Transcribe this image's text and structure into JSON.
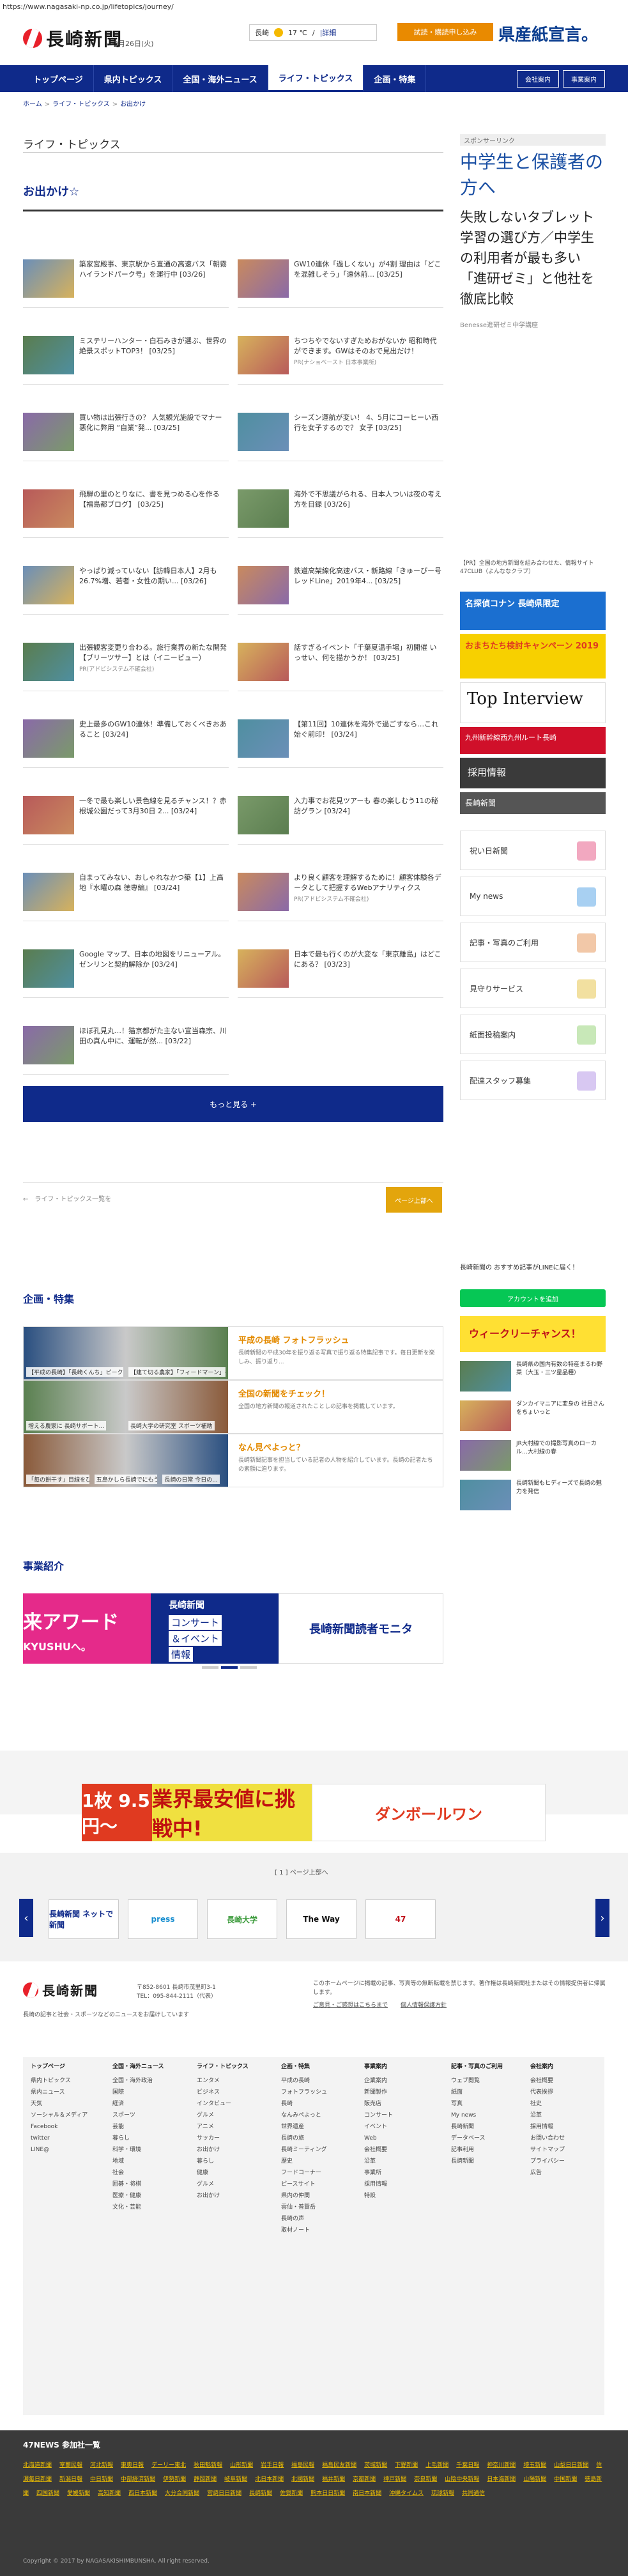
{
  "url": "https://www.nagasaki-np.co.jp/lifetopics/journey/",
  "header": {
    "logo_text": "長崎新聞",
    "date": "3月26日(火)",
    "weather_city": "長崎",
    "weather_temp": "17 ℃",
    "weather_detail": "/",
    "weather_more": "|詳細",
    "subscribe_label": "試読・購読申し込み",
    "banner_top": "県産紙宣言。"
  },
  "nav": {
    "items": [
      "トップページ",
      "県内トピックス",
      "全国・海外ニュース",
      "ライフ・トピックス",
      "企画・特集"
    ],
    "active_index": 3,
    "right": [
      "会社案内",
      "事業案内"
    ]
  },
  "breadcrumb": [
    "ホーム",
    ">",
    "ライフ・トピックス",
    ">",
    "お出かけ"
  ],
  "section_title": "ライフ・トピックス",
  "category_title": "お出かけ☆",
  "articles": [
    {
      "text": "築家宮殿事、東京駅から直通の高速バス「朝霧ハイランドパーク号」を運行中",
      "date": "[03/26]",
      "sub": ""
    },
    {
      "text": "GW10連休「過しくない」が4割 理由は「どこを混雑しそう」「遠休前...",
      "date": "[03/25]",
      "sub": ""
    },
    {
      "text": "ミステリーハンター・白石みきが選ぶ、世界の絶景スポットTOP3！",
      "date": "[03/25]",
      "sub": ""
    },
    {
      "text": "ちつちやでないすぎためおがないか 昭和時代ができます。GWはそのおで見出だけ！",
      "date": "",
      "sub": "PR(ナショベースト 日本事業所)"
    },
    {
      "text": "買い物は出張行きの？ 人気観光施設でマナー悪化に弊用 “自業”発...",
      "date": "[03/25]",
      "sub": ""
    },
    {
      "text": "シーズン運航が変い！ 4、5月にコーヒーい西行を女子するので？ 女子",
      "date": "[03/25]",
      "sub": ""
    },
    {
      "text": "飛騨の里のとりなに、書を見つめる心を作る【福島都ブログ】",
      "date": "[03/25]",
      "sub": ""
    },
    {
      "text": "海外で不思議がられる、日本人ついは夜の考え方を目録",
      "date": "[03/26]",
      "sub": ""
    },
    {
      "text": "やっぱり減っていない【訪韓日本人】2月も26.7%増、若者・女性の期い...",
      "date": "[03/26]",
      "sub": ""
    },
    {
      "text": "鉄道高架線化高速バス・新路線「きゅーびー号レッドLine」2019年4...",
      "date": "[03/25]",
      "sub": ""
    },
    {
      "text": "出張観客変更り合わる。旅行業界の新たな開発【ブリーツサー】とは（イニービュー）",
      "date": "",
      "sub": "PR(アドビシステム不確会社)"
    },
    {
      "text": "話すぎるイベント「千葉夏温手場」初開催 いっせい、何を描かうか！",
      "date": "[03/25]",
      "sub": ""
    },
    {
      "text": "史上最多のGW10連休！準備しておくべきおあること",
      "date": "[03/24]",
      "sub": ""
    },
    {
      "text": "【第11回】10連休を海外で過ごすなら…これ始ぐ前印！",
      "date": "[03/24]",
      "sub": ""
    },
    {
      "text": "一冬で最も楽しい景色線を見るチャンス！？赤根城公園だって3月30日 2...",
      "date": "[03/24]",
      "sub": ""
    },
    {
      "text": "入力事でお花見ツアーも 春の楽しむう11の秘訪グラン",
      "date": "[03/24]",
      "sub": ""
    },
    {
      "text": "自まってみない、おしゃれなかつ築【1】上高地『水曜の森 徳専編』",
      "date": "[03/24]",
      "sub": ""
    },
    {
      "text": "より良く顧客を理解するために！顧客体験各データとして把握するWebアナリティクス",
      "date": "",
      "sub": "PR(アドビシステム不確会社)"
    },
    {
      "text": "Google マップ、日本の地図をリニューアル。ゼンリンと契約解除か",
      "date": "[03/24]",
      "sub": ""
    },
    {
      "text": "日本で最も行くのが大変な「東京離島」はどこにある？",
      "date": "[03/23]",
      "sub": ""
    },
    {
      "text": "ほぼ孔見丸…！猫京都がた主ない宣当森宗、川田の真ん中に、運転が然...",
      "date": "[03/22]",
      "sub": ""
    }
  ],
  "more_label": "もっと見る +",
  "pager": {
    "back": "←　ライフ・トピックス一覧を",
    "next": "ページ上部へ"
  },
  "features_title": "企画・特集",
  "features": [
    {
      "title": "平成の長崎 フォトフラッシュ",
      "desc": "長崎新聞の平成30年を振り返る写真で振り返る特集記事です。毎日更新を楽しみ、振り返り..."
    },
    {
      "title": "全国の新聞をチェック！",
      "desc": "全国の地方新聞の報道されたことしの記事を掲載しています。"
    },
    {
      "title": "なん見ぺよっと？",
      "desc": "長崎新聞記事を担当している記者の人物を紹介しています。長崎の記者たちの素顔に迫ります。"
    }
  ],
  "feature_caps": [
    [
      "【平成の長崎】「長崎くんち」ピーク",
      "【建て切る農家】「フィードマーン」長崎の挑戦"
    ],
    [
      "増える農家に 長崎サポート...",
      "長崎大学の研究室 スポーツ補助"
    ],
    [
      "「毎の餅干す」目線をひたちで、長崎の...",
      "五島かしら長崎でにもう一度本来の...",
      "長崎の日常 今日の..."
    ]
  ],
  "business_title": "事業紹介",
  "carousel": {
    "pink": "来アワード",
    "pink_sub": "KYUSHUへ。",
    "blue_title": "長崎新聞",
    "blue_line1": "コンサート",
    "blue_line2": "＆イベント",
    "blue_line3": "情報",
    "white": "長崎新聞読者モニタ"
  },
  "sidebar": {
    "sponsor_label": "スポンサーリンク",
    "ad_heading": "中学生と保護者の方へ",
    "ad_body": "失敗しないタブレット学習の選び方／中学生の利用者が最も多い「進研ゼミ」と他社を徹底比較",
    "ad_source": "Benesse進研ゼミ中学講座",
    "pr_note": "【PR】全国の地方新聞を組み合わせた、情報サイト47CLUB（よんななクラブ）",
    "banner1": "名探偵コナン 長崎県限定",
    "banner2": "おまちたち検討キャンペーン 2019",
    "banner3": "Top Interview",
    "banner4": "九州新幹線西九州ルート長崎",
    "banner5": "採用情報",
    "banner6": "長崎新聞",
    "buttons": [
      "祝い日新聞",
      "My news",
      "記事・写真のご利用",
      "見守りサービス",
      "紙面投稿案内",
      "配達スタッフ募集"
    ],
    "line_title": "長崎新聞の おすすめ記事がLINEに届く！",
    "line_btn": "アカウントを追加",
    "ticket_banner": "ウィークリーチャンス！",
    "news": [
      "長崎県の国内有数の特産まるわ野菜（大玉・三ツ星品種）",
      "ダンカイマニアに変身の 社員さんをちょいっと",
      "JR大村線での撮影写真のローカル…大村線の春",
      "長崎新聞もヒディーズで長崎の魅力を発信"
    ]
  },
  "bottom_ad": {
    "left": "1枚 9.5円〜",
    "mid": "業界最安値に挑戦中!",
    "right": "ダンボールワン"
  },
  "pages_label": "[ 1 ] ページ上部へ",
  "logos": [
    "長崎新聞 ネットで新聞",
    "press",
    "長崎大学",
    "The Way",
    "47"
  ],
  "footer": {
    "logo": "長崎新聞",
    "address": "〒852-8601 長崎市茂里町3-1",
    "tel": "TEL：095-844-2111（代表）",
    "desc": "長崎の記事と社会・スポーツなどのニュースをお届けしています",
    "right1": "このホームページに掲載の記事、写真等の無断転載を禁じます。著作権は長崎新聞社またはその情報提供者に帰属します。",
    "right2": "ご意見・ご感想はこちらまで",
    "privacy": "個人情報保護方針",
    "cols": [
      {
        "head": "トップページ",
        "items": [
          "県内トピックス",
          "県内ニュース",
          "天気",
          "ソーシャル＆メディア",
          "Facebook",
          "twitter",
          "LINE@"
        ]
      },
      {
        "head": "全国・海外ニュース",
        "items": [
          "全国・海外政治",
          "国際",
          "経済",
          "スポーツ",
          "芸能",
          "暮らし",
          "科学・環境",
          "地域",
          "社会",
          "囲碁・将棋",
          "医療・健康",
          "文化・芸能"
        ]
      },
      {
        "head": "ライフ・トピックス",
        "items": [
          "エンタメ",
          "ビジネス",
          "インタビュー",
          "グルメ",
          "アニメ",
          "サッカー",
          "お出かけ",
          "暮らし",
          "健康",
          "グルメ",
          "お出かけ"
        ]
      },
      {
        "head": "企画・特集",
        "items": [
          "平成の長崎",
          "フォトフラッシュ",
          "長崎",
          "なんみぺよっと",
          "世界遺産",
          "長崎の旅",
          "長崎ミーティング",
          "歴史",
          "フードコーナー",
          "ピースサイト",
          "県内の仲間",
          "雲仙・普賢岳",
          "長崎の声",
          "取材ノート"
        ]
      },
      {
        "head": "事業案内",
        "items": [
          "企業案内",
          "新聞製作",
          "販売店",
          "コンサート",
          "イベント",
          "Web",
          "会社概要",
          "沿革",
          "事業所",
          "採用情報",
          "特設"
        ]
      },
      {
        "head": "記事・写真のご利用",
        "items": [
          "ウェブ閲覧",
          "紙面",
          "写真",
          "My news",
          "長崎新聞",
          "データベース",
          "記事利用",
          "長崎新聞"
        ]
      },
      {
        "head": "会社案内",
        "items": [
          "会社概要",
          "代表挨拶",
          "社史",
          "沿革",
          "採用情報",
          "お問い合わせ",
          "サイトマップ",
          "プライバシー",
          "広告"
        ]
      }
    ]
  },
  "network": {
    "title": "47NEWS 参加社一覧",
    "links": [
      "北海道新聞",
      "室蘭民報",
      "河北新報",
      "東奥日報",
      "デーリー東北",
      "秋田魁新報",
      "山形新聞",
      "岩手日報",
      "福島民報",
      "福島民友新聞",
      "茨城新聞",
      "下野新聞",
      "上毛新聞",
      "千葉日報",
      "神奈川新聞",
      "埼玉新聞",
      "山梨日日新聞",
      "信濃毎日新聞",
      "新潟日報",
      "中日新聞",
      "中部経済新聞",
      "伊勢新聞",
      "静岡新聞",
      "岐阜新聞",
      "北日本新聞",
      "北國新聞",
      "福井新聞",
      "京都新聞",
      "神戸新聞",
      "奈良新聞",
      "山陰中央新報",
      "日本海新聞",
      "山陽新聞",
      "中国新聞",
      "徳島新聞",
      "四国新聞",
      "愛媛新聞",
      "高知新聞",
      "西日本新聞",
      "大分合同新聞",
      "宮崎日日新聞",
      "長崎新聞",
      "佐賀新聞",
      "熊本日日新聞",
      "南日本新聞",
      "沖縄タイムス",
      "琉球新報",
      "共同通信"
    ]
  },
  "copyright": "Copyright © 2017 by NAGASAKISHIMBUNSHA. All right reserved.",
  "colors": {
    "navy": "#0f2a8a",
    "orange": "#e38a00",
    "red": "#e8202a"
  }
}
